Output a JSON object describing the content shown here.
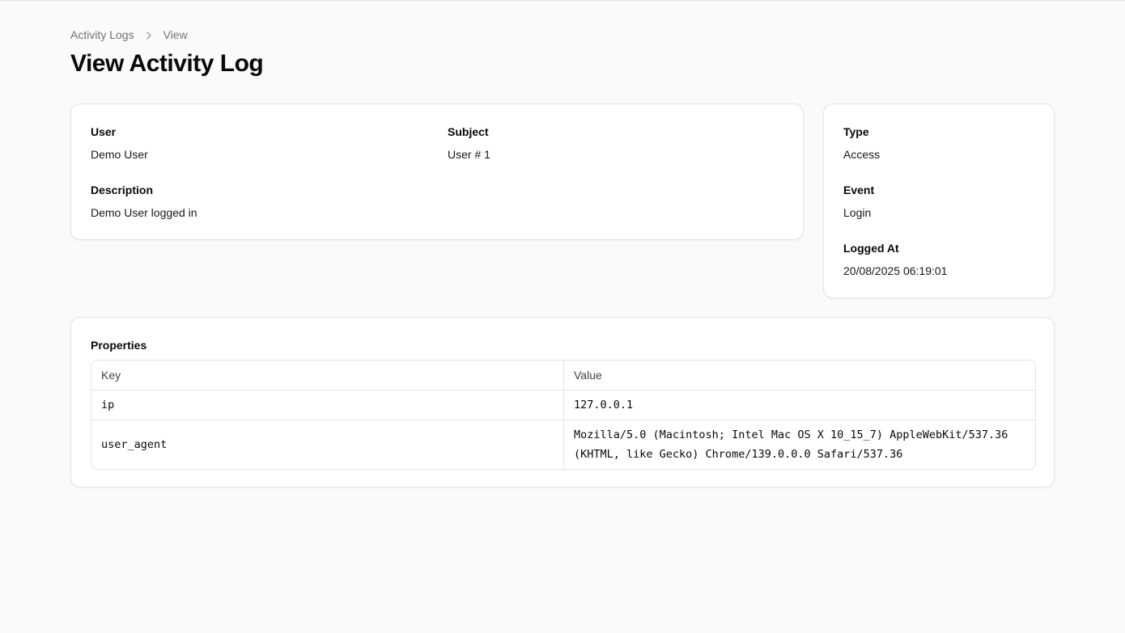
{
  "breadcrumb": {
    "parent": "Activity Logs",
    "current": "View"
  },
  "page": {
    "title": "View Activity Log"
  },
  "main_card": {
    "user_label": "User",
    "user_value": "Demo User",
    "subject_label": "Subject",
    "subject_value": "User # 1",
    "description_label": "Description",
    "description_value": "Demo User logged in"
  },
  "side_card": {
    "type_label": "Type",
    "type_value": "Access",
    "event_label": "Event",
    "event_value": "Login",
    "logged_at_label": "Logged At",
    "logged_at_value": "20/08/2025 06:19:01"
  },
  "properties": {
    "label": "Properties",
    "key_header": "Key",
    "value_header": "Value",
    "rows": [
      {
        "key": "ip",
        "value": "127.0.0.1"
      },
      {
        "key": "user_agent",
        "value": "Mozilla/5.0 (Macintosh; Intel Mac OS X 10_15_7) AppleWebKit/537.36 (KHTML, like Gecko) Chrome/139.0.0.0 Safari/537.36"
      }
    ]
  },
  "icons": {
    "breadcrumb_separator": "chevron-right-icon"
  },
  "colors": {
    "background": "#fafafa",
    "card": "#ffffff",
    "border": "#e4e4e7",
    "muted_text": "#71717a"
  }
}
